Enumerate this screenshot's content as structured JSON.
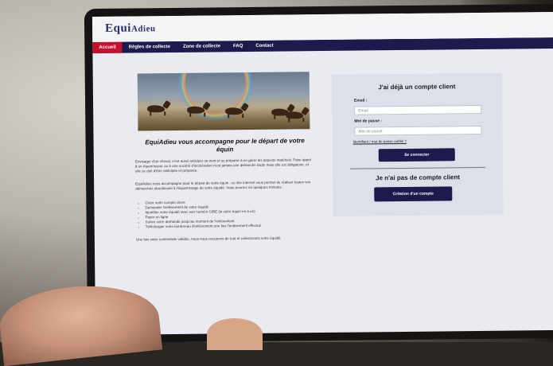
{
  "site": {
    "logo_main": "Equi",
    "logo_small": "Adieu",
    "nav": [
      "Accueil",
      "Règles de collecte",
      "Zone de collecte",
      "FAQ",
      "Contact"
    ],
    "headline": "EquiAdieu vous accompagne pour le départ de votre équin",
    "para1": "Envisager d'un cheval, c'est aussi anticiper sa mort et se préparer à en gérer les aspects matériels. Faire appel à un équarrisseur ou à une société d'incinération n'est jamais une démarche facile mais elle est obligatoire, et elle se doit d'être anticipée et préparée.",
    "para2": "EquiAdieu vous accompagne pour le départ de votre équin : ce site internet vous permet de réaliser toutes vos démarches aboutissant à l'équarrissage de votre équidé. Vous pourrez en quelques minutes :",
    "bullets": [
      "Créer votre compte client",
      "Demander l'enlèvement de votre équidé",
      "Identifier votre équidé avec son numéro SIRE (si votre équin en a un)",
      "Payer en ligne",
      "Suivre votre demande jusqu'au moment de l'enlèvement",
      "Télécharger votre bordereau d'enlèvement une fois l'enlèvement effectué"
    ],
    "para3": "Une fois votre commande validée, nous nous occupons de tout et collecterons votre équidé",
    "login": {
      "title": "J'ai déjà un compte client",
      "email_label": "Email :",
      "email_placeholder": "Email",
      "password_label": "Mot de passe :",
      "password_placeholder": "Mot de passe",
      "forgot": "Identifiant / mot de passe oublié ?",
      "submit": "Se connecter"
    },
    "register": {
      "title": "Je n'ai pas de compte client",
      "button": "Création d'un compte"
    }
  }
}
